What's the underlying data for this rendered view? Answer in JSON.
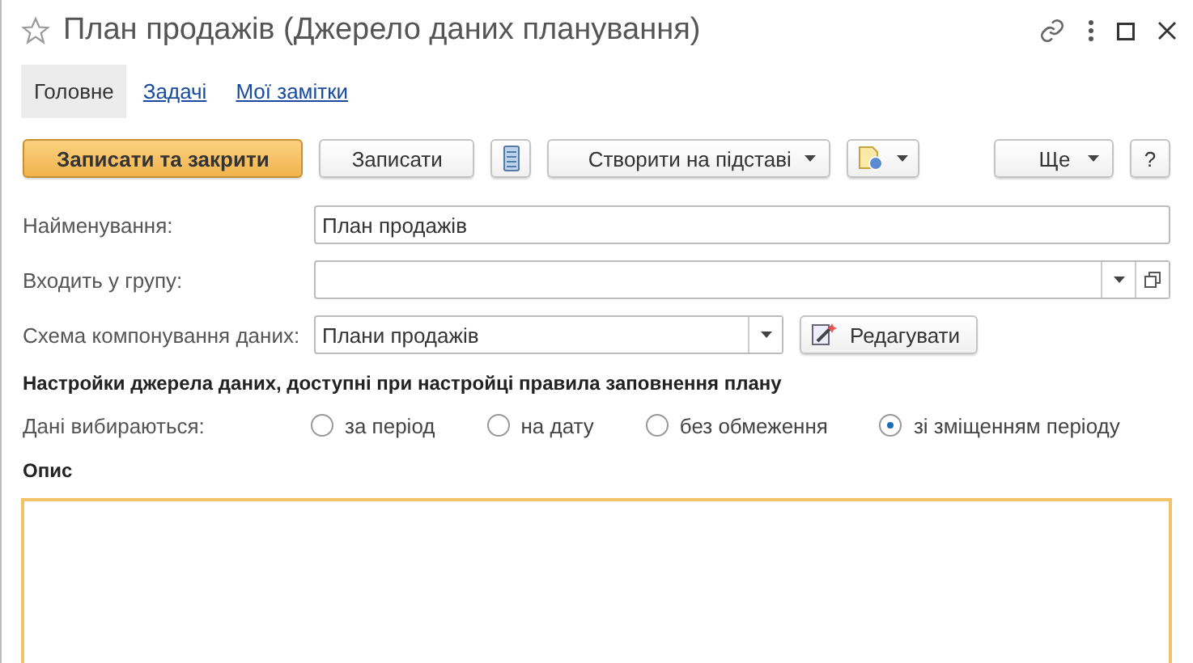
{
  "window": {
    "title": "План продажів (Джерело даних планування)",
    "favorite": false
  },
  "tabs": [
    {
      "label": "Головне",
      "selected": true
    },
    {
      "label": "Задачі",
      "selected": false
    },
    {
      "label": "Мої замітки",
      "selected": false
    }
  ],
  "toolbar": [
    {
      "kind": "primary",
      "label": "Записати та закрити"
    },
    {
      "kind": "button",
      "label": "Записати"
    },
    {
      "kind": "icon"
    },
    {
      "kind": "menu",
      "label": "Створити на підставі"
    },
    {
      "kind": "iconmenu"
    },
    {
      "kind": "spacer"
    },
    {
      "kind": "menu",
      "label": "Ще"
    },
    {
      "kind": "button",
      "label": "?"
    }
  ],
  "fields": [
    {
      "kind": "text",
      "label": "Найменування:",
      "value": "План продажів"
    },
    {
      "kind": "group",
      "label": "Входить у групу:"
    },
    {
      "kind": "select",
      "label": "Схема компонування даних:",
      "value": "Плани продажів",
      "button": "Редагувати"
    }
  ],
  "settings": {
    "heading": "Настройки джерела даних, доступні при настройці правила заповнення плану",
    "label": "Дані вибираються:",
    "options": [
      {
        "label": "за період",
        "selected": false
      },
      {
        "label": "на дату",
        "selected": false
      },
      {
        "label": "без обмеження",
        "selected": false
      },
      {
        "label": "зі зміщенням періоду",
        "selected": true
      }
    ]
  },
  "description": {
    "label": "Опис"
  }
}
